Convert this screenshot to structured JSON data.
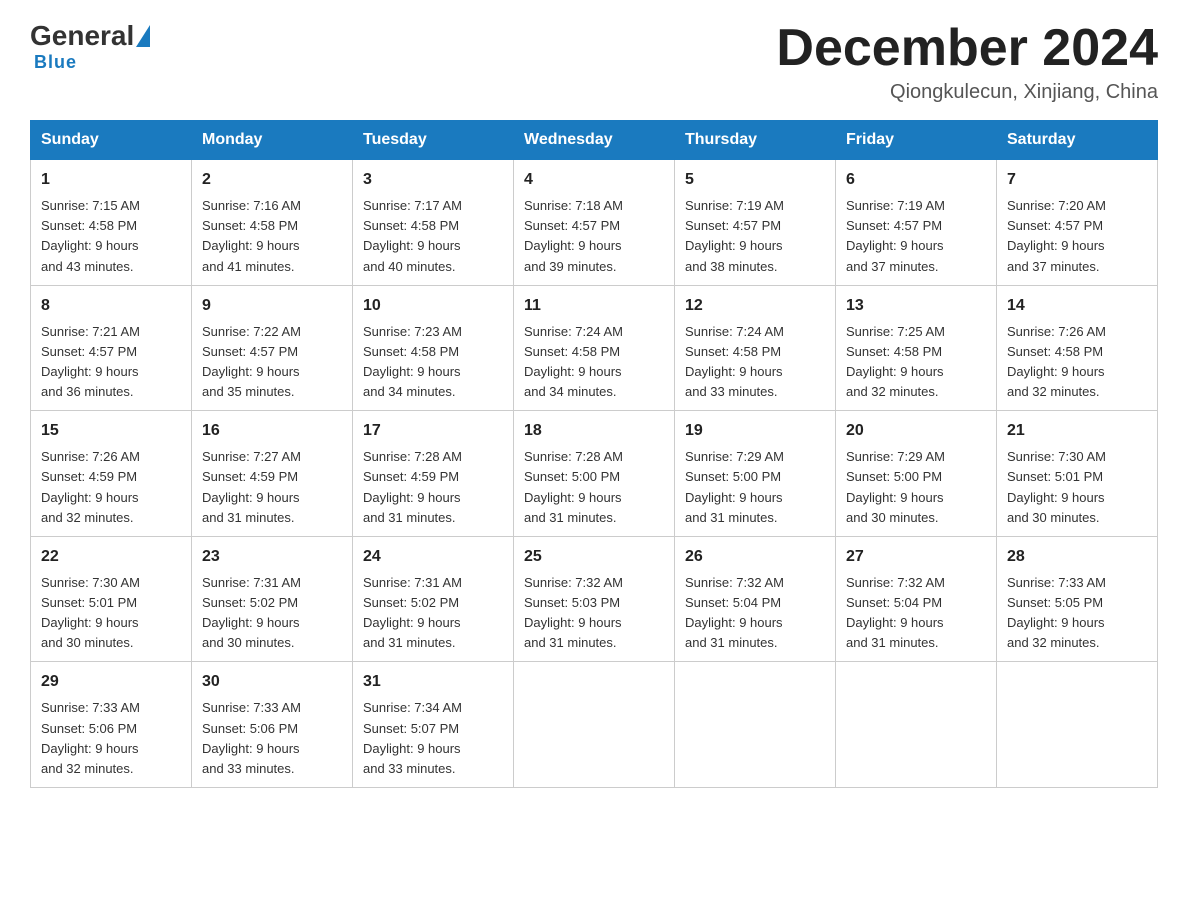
{
  "header": {
    "logo_general": "General",
    "logo_blue": "Blue",
    "month_year": "December 2024",
    "location": "Qiongkulecun, Xinjiang, China"
  },
  "days_of_week": [
    "Sunday",
    "Monday",
    "Tuesday",
    "Wednesday",
    "Thursday",
    "Friday",
    "Saturday"
  ],
  "weeks": [
    [
      {
        "day": "1",
        "sunrise": "7:15 AM",
        "sunset": "4:58 PM",
        "daylight": "9 hours and 43 minutes."
      },
      {
        "day": "2",
        "sunrise": "7:16 AM",
        "sunset": "4:58 PM",
        "daylight": "9 hours and 41 minutes."
      },
      {
        "day": "3",
        "sunrise": "7:17 AM",
        "sunset": "4:58 PM",
        "daylight": "9 hours and 40 minutes."
      },
      {
        "day": "4",
        "sunrise": "7:18 AM",
        "sunset": "4:57 PM",
        "daylight": "9 hours and 39 minutes."
      },
      {
        "day": "5",
        "sunrise": "7:19 AM",
        "sunset": "4:57 PM",
        "daylight": "9 hours and 38 minutes."
      },
      {
        "day": "6",
        "sunrise": "7:19 AM",
        "sunset": "4:57 PM",
        "daylight": "9 hours and 37 minutes."
      },
      {
        "day": "7",
        "sunrise": "7:20 AM",
        "sunset": "4:57 PM",
        "daylight": "9 hours and 37 minutes."
      }
    ],
    [
      {
        "day": "8",
        "sunrise": "7:21 AM",
        "sunset": "4:57 PM",
        "daylight": "9 hours and 36 minutes."
      },
      {
        "day": "9",
        "sunrise": "7:22 AM",
        "sunset": "4:57 PM",
        "daylight": "9 hours and 35 minutes."
      },
      {
        "day": "10",
        "sunrise": "7:23 AM",
        "sunset": "4:58 PM",
        "daylight": "9 hours and 34 minutes."
      },
      {
        "day": "11",
        "sunrise": "7:24 AM",
        "sunset": "4:58 PM",
        "daylight": "9 hours and 34 minutes."
      },
      {
        "day": "12",
        "sunrise": "7:24 AM",
        "sunset": "4:58 PM",
        "daylight": "9 hours and 33 minutes."
      },
      {
        "day": "13",
        "sunrise": "7:25 AM",
        "sunset": "4:58 PM",
        "daylight": "9 hours and 32 minutes."
      },
      {
        "day": "14",
        "sunrise": "7:26 AM",
        "sunset": "4:58 PM",
        "daylight": "9 hours and 32 minutes."
      }
    ],
    [
      {
        "day": "15",
        "sunrise": "7:26 AM",
        "sunset": "4:59 PM",
        "daylight": "9 hours and 32 minutes."
      },
      {
        "day": "16",
        "sunrise": "7:27 AM",
        "sunset": "4:59 PM",
        "daylight": "9 hours and 31 minutes."
      },
      {
        "day": "17",
        "sunrise": "7:28 AM",
        "sunset": "4:59 PM",
        "daylight": "9 hours and 31 minutes."
      },
      {
        "day": "18",
        "sunrise": "7:28 AM",
        "sunset": "5:00 PM",
        "daylight": "9 hours and 31 minutes."
      },
      {
        "day": "19",
        "sunrise": "7:29 AM",
        "sunset": "5:00 PM",
        "daylight": "9 hours and 31 minutes."
      },
      {
        "day": "20",
        "sunrise": "7:29 AM",
        "sunset": "5:00 PM",
        "daylight": "9 hours and 30 minutes."
      },
      {
        "day": "21",
        "sunrise": "7:30 AM",
        "sunset": "5:01 PM",
        "daylight": "9 hours and 30 minutes."
      }
    ],
    [
      {
        "day": "22",
        "sunrise": "7:30 AM",
        "sunset": "5:01 PM",
        "daylight": "9 hours and 30 minutes."
      },
      {
        "day": "23",
        "sunrise": "7:31 AM",
        "sunset": "5:02 PM",
        "daylight": "9 hours and 30 minutes."
      },
      {
        "day": "24",
        "sunrise": "7:31 AM",
        "sunset": "5:02 PM",
        "daylight": "9 hours and 31 minutes."
      },
      {
        "day": "25",
        "sunrise": "7:32 AM",
        "sunset": "5:03 PM",
        "daylight": "9 hours and 31 minutes."
      },
      {
        "day": "26",
        "sunrise": "7:32 AM",
        "sunset": "5:04 PM",
        "daylight": "9 hours and 31 minutes."
      },
      {
        "day": "27",
        "sunrise": "7:32 AM",
        "sunset": "5:04 PM",
        "daylight": "9 hours and 31 minutes."
      },
      {
        "day": "28",
        "sunrise": "7:33 AM",
        "sunset": "5:05 PM",
        "daylight": "9 hours and 32 minutes."
      }
    ],
    [
      {
        "day": "29",
        "sunrise": "7:33 AM",
        "sunset": "5:06 PM",
        "daylight": "9 hours and 32 minutes."
      },
      {
        "day": "30",
        "sunrise": "7:33 AM",
        "sunset": "5:06 PM",
        "daylight": "9 hours and 33 minutes."
      },
      {
        "day": "31",
        "sunrise": "7:34 AM",
        "sunset": "5:07 PM",
        "daylight": "9 hours and 33 minutes."
      },
      null,
      null,
      null,
      null
    ]
  ],
  "labels": {
    "sunrise": "Sunrise:",
    "sunset": "Sunset:",
    "daylight": "Daylight:"
  }
}
